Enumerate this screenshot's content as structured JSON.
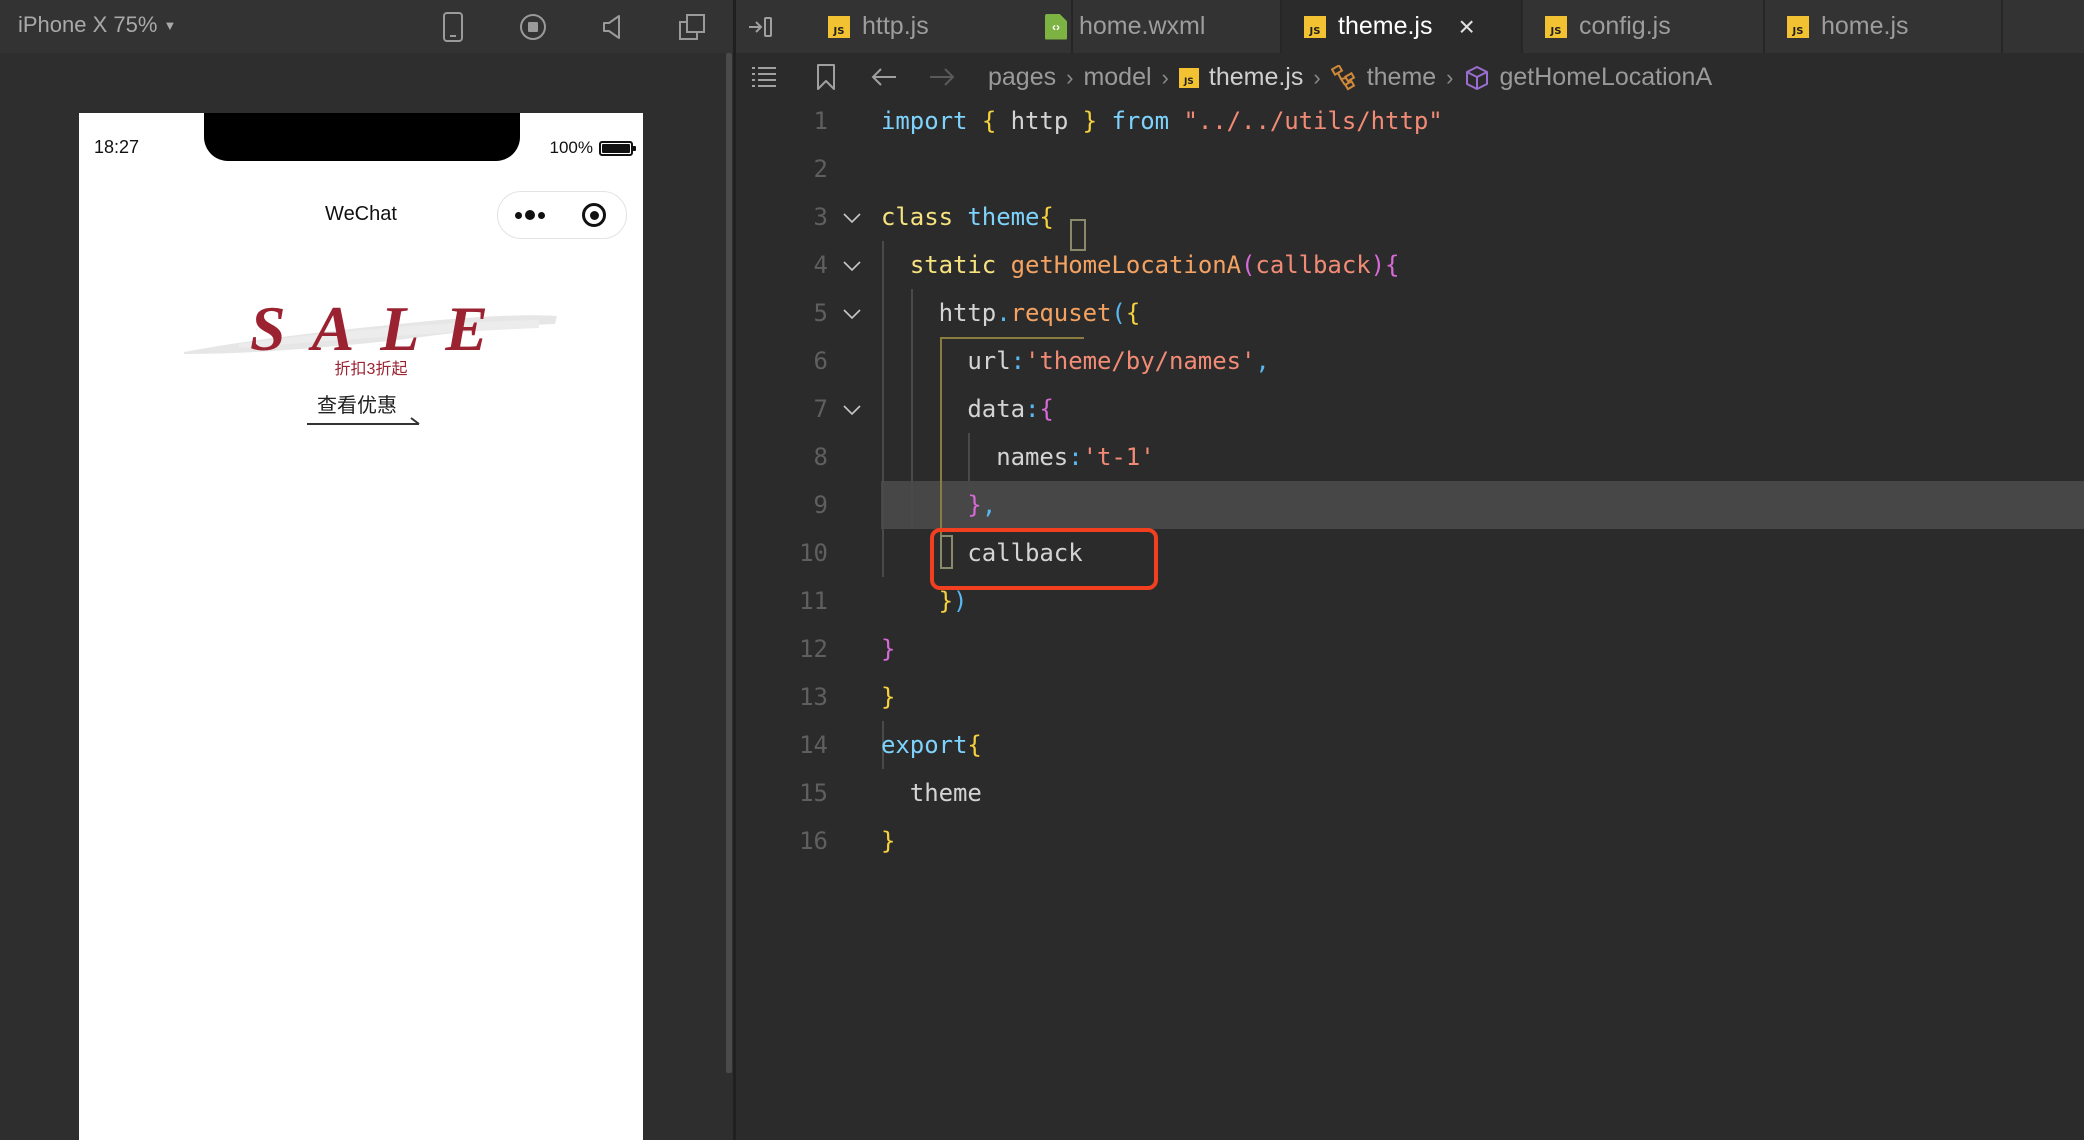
{
  "simulator": {
    "device_label": "iPhone X 75%",
    "toolbar_icons": [
      "phone-icon",
      "stop-record-icon",
      "volume-icon",
      "window-icon"
    ],
    "status_bar": {
      "time": "18:27",
      "battery": "100%"
    },
    "nav_title": "WeChat",
    "capsule": {
      "menu_icon": "more-dots-icon",
      "close_icon": "target-icon"
    },
    "banner": {
      "title": "SALE",
      "subtitle": "折扣3折起",
      "cta": "查看优惠"
    }
  },
  "editor": {
    "tabs": [
      {
        "label": "http.js",
        "icon": "js-file-icon",
        "active": false
      },
      {
        "label": "home.wxml",
        "icon": "wxml-file-icon",
        "active": false
      },
      {
        "label": "theme.js",
        "icon": "js-file-icon",
        "active": true,
        "close": "×"
      },
      {
        "label": "config.js",
        "icon": "js-file-icon",
        "active": false
      },
      {
        "label": "home.js",
        "icon": "js-file-icon",
        "active": false
      }
    ],
    "breadcrumb": {
      "items": [
        "pages",
        "model",
        "theme.js",
        "theme",
        "getHomeLocationA"
      ],
      "separator": "›"
    },
    "current_line": 9,
    "highlighted_line": 10,
    "lines": [
      {
        "n": "1",
        "tokens": [
          [
            "kw",
            "import"
          ],
          [
            "plain",
            " "
          ],
          [
            "brace-y",
            "{"
          ],
          [
            "plain",
            " http "
          ],
          [
            "brace-y",
            "}"
          ],
          [
            "plain",
            " "
          ],
          [
            "kw",
            "from"
          ],
          [
            "plain",
            " "
          ],
          [
            "str",
            "\"../../utils/http\""
          ]
        ]
      },
      {
        "n": "2",
        "tokens": []
      },
      {
        "n": "3",
        "tokens": [
          [
            "kw2",
            "class"
          ],
          [
            "plain",
            " "
          ],
          [
            "cls",
            "theme"
          ],
          [
            "brace-y",
            "{"
          ]
        ]
      },
      {
        "n": "4",
        "tokens": [
          [
            "plain",
            "  "
          ],
          [
            "kw2",
            "static"
          ],
          [
            "plain",
            " "
          ],
          [
            "fn",
            "getHomeLocationA"
          ],
          [
            "brace-p",
            "("
          ],
          [
            "param",
            "callback"
          ],
          [
            "brace-p",
            ")"
          ],
          [
            "brace-p",
            "{"
          ]
        ]
      },
      {
        "n": "5",
        "tokens": [
          [
            "plain",
            "    http"
          ],
          [
            "punc-b",
            "."
          ],
          [
            "fn",
            "requset"
          ],
          [
            "punc-b",
            "("
          ],
          [
            "brace-y",
            "{"
          ]
        ]
      },
      {
        "n": "6",
        "tokens": [
          [
            "plain",
            "      url"
          ],
          [
            "punc-b",
            ":"
          ],
          [
            "str",
            "'theme/by/names'"
          ],
          [
            "punc-b",
            ","
          ]
        ]
      },
      {
        "n": "7",
        "tokens": [
          [
            "plain",
            "      data"
          ],
          [
            "punc-b",
            ":"
          ],
          [
            "brace-p",
            "{"
          ]
        ]
      },
      {
        "n": "8",
        "tokens": [
          [
            "plain",
            "        names"
          ],
          [
            "punc-b",
            ":"
          ],
          [
            "str",
            "'t-1'"
          ]
        ]
      },
      {
        "n": "9",
        "tokens": [
          [
            "plain",
            "      "
          ],
          [
            "brace-p",
            "}"
          ],
          [
            "punc-b",
            ","
          ]
        ]
      },
      {
        "n": "10",
        "tokens": [
          [
            "plain",
            "      callback"
          ]
        ]
      },
      {
        "n": "11",
        "tokens": [
          [
            "plain",
            "    "
          ],
          [
            "brace-y",
            "}"
          ],
          [
            "punc-b",
            ")"
          ]
        ]
      },
      {
        "n": "12",
        "tokens": [
          [
            "brace-p",
            "}"
          ]
        ]
      },
      {
        "n": "13",
        "tokens": [
          [
            "brace-y",
            "}"
          ]
        ]
      },
      {
        "n": "14",
        "tokens": [
          [
            "kw",
            "export"
          ],
          [
            "brace-y",
            "{"
          ]
        ]
      },
      {
        "n": "15",
        "tokens": [
          [
            "plain",
            "  theme"
          ]
        ]
      },
      {
        "n": "16",
        "tokens": [
          [
            "brace-y",
            "}"
          ]
        ]
      }
    ],
    "foldable_lines": [
      3,
      4,
      5,
      7
    ]
  },
  "colors": {
    "sale_red": "#9b2231",
    "annotation_red": "#f23f1f",
    "js_badge": "#f2c233",
    "wxml_badge": "#7cb342"
  }
}
